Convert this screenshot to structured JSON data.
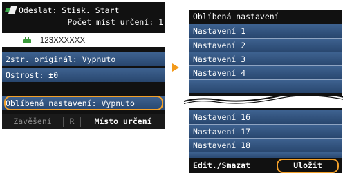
{
  "left_screen": {
    "status_label": "Odeslat: Stisk. Start",
    "destinations_label": "Počet míst určení: 1",
    "fax_number": "= 123XXXXXX",
    "setting_duplex": "2str. originál: Vypnuto",
    "setting_sharpness": "Ostrost: ±0",
    "setting_favorites": "Oblíbená nastavení: Vypnuto",
    "bottom_left": "Zavěšení",
    "bottom_mid": "R",
    "bottom_right": "Místo určení"
  },
  "right_screen": {
    "title": "Oblíbená nastavení",
    "items_top": [
      "Nastavení 1",
      "Nastavení 2",
      "Nastavení 3",
      "Nastavení 4"
    ],
    "items_bottom": [
      "Nastavení 16",
      "Nastavení 17",
      "Nastavení 18"
    ],
    "edit_label": "Edit./Smazat",
    "save_label": "Uložit"
  },
  "colors": {
    "highlight": "#f3a02a",
    "row_blue": "#3e6290",
    "screen_bg": "#111111"
  },
  "icons": [
    "send-icon",
    "fax-icon",
    "arrow-right-icon"
  ]
}
